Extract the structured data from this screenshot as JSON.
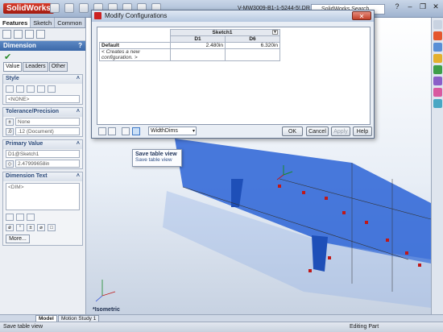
{
  "app": {
    "logo": "SolidWorks",
    "filename": "V-MW3009-B1-1-5244-5!.DR",
    "search_placeholder": "SolidWorks Search"
  },
  "left_panel": {
    "tabs": [
      "Features",
      "Sketch",
      "Common"
    ],
    "property_title": "Dimension",
    "help": "?",
    "subtabs": [
      "Value",
      "Leaders",
      "Other"
    ],
    "style": {
      "title": "Style",
      "value": "<NONE>"
    },
    "tolerance": {
      "title": "Tolerance/Precision",
      "tolerance_type": "None",
      "precision": ".12 (Document)"
    },
    "primary_value": {
      "title": "Primary Value",
      "name": "D1@Sketch1",
      "value": "2.47999658in"
    },
    "dimension_text": {
      "title": "Dimension Text",
      "text": "<DIM>"
    },
    "more_button": "More..."
  },
  "dialog": {
    "title": "Modify Configurations",
    "sketch_header": "Sketch1",
    "columns": [
      "D1",
      "D6"
    ],
    "rows": [
      {
        "name": "Default",
        "values": [
          "2.480in",
          "6.320in"
        ]
      },
      {
        "name": "< Creates a new configuration. >",
        "values": [
          "",
          ""
        ]
      }
    ],
    "view_combo": "WidthDims",
    "buttons": {
      "ok": "OK",
      "cancel": "Cancel",
      "apply": "Apply",
      "help": "Help"
    }
  },
  "tooltip": {
    "title": "Save table view",
    "body": "Save table view"
  },
  "viewport": {
    "view_label": "*Isometric"
  },
  "bottom_tabs": [
    "Model",
    "Motion Study 1"
  ],
  "status": {
    "left": "Save table view",
    "right": "Editing Part"
  }
}
